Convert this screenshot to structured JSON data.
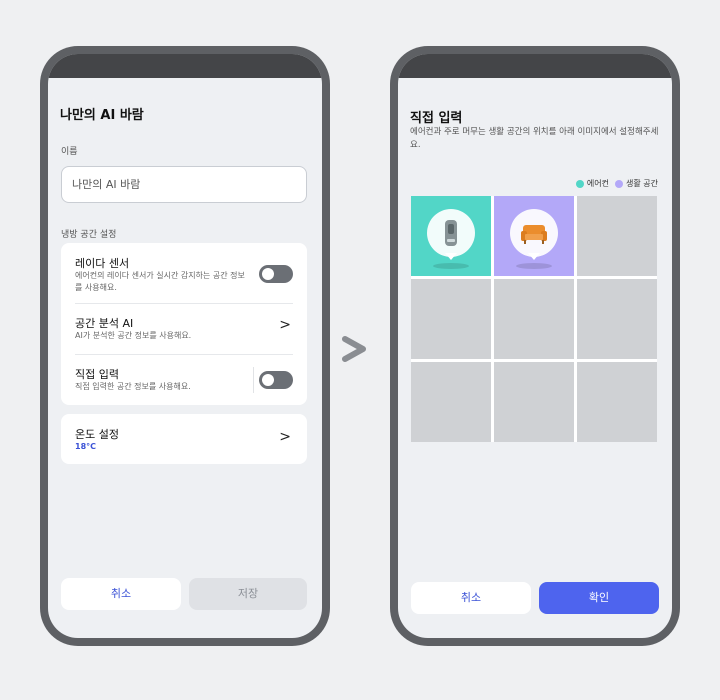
{
  "left": {
    "title": "나만의 AI 바람",
    "name_label": "이름",
    "name_value": "나만의 AI 바람",
    "space_section_label": "냉방 공간 설정",
    "settings": [
      {
        "title": "레이다 센서",
        "subtitle": "에어컨의 레이다 센서가 실시간 감지하는 공간 정보를 사용해요.",
        "control": "toggle"
      },
      {
        "title": "공간 분석 AI",
        "subtitle": "AI가 분석한 공간 정보를 사용해요.",
        "control": "chevron"
      },
      {
        "title": "직접 입력",
        "subtitle": "직접 입력한 공간 정보를 사용해요.",
        "control": "toggle"
      }
    ],
    "temperature": {
      "title": "온도 설정",
      "value": "18°C"
    },
    "buttons": {
      "cancel": "취소",
      "save": "저장"
    }
  },
  "arrow_glyph": ">",
  "right": {
    "title": "직접 입력",
    "description": "에어컨과 주로 머무는 생활 공간의 위치를 아래 이미지에서 설정해주세요.",
    "legend": [
      {
        "label": "에어컨",
        "color": "#52d6c7"
      },
      {
        "label": "생활 공간",
        "color": "#b3a8f8"
      }
    ],
    "grid": {
      "rows": 3,
      "cols": 3,
      "air_conditioner_cell": [
        0,
        0
      ],
      "living_space_cell": [
        0,
        1
      ]
    },
    "buttons": {
      "cancel": "취소",
      "confirm": "확인"
    }
  },
  "colors": {
    "accent_blue": "#4e64ee",
    "ac_cell": "#52d6c7",
    "living_cell": "#b3a8f8",
    "toggle_off": "#6b6f75"
  },
  "icons": [
    "chevron-right-icon",
    "air-conditioner-icon",
    "sofa-icon"
  ]
}
